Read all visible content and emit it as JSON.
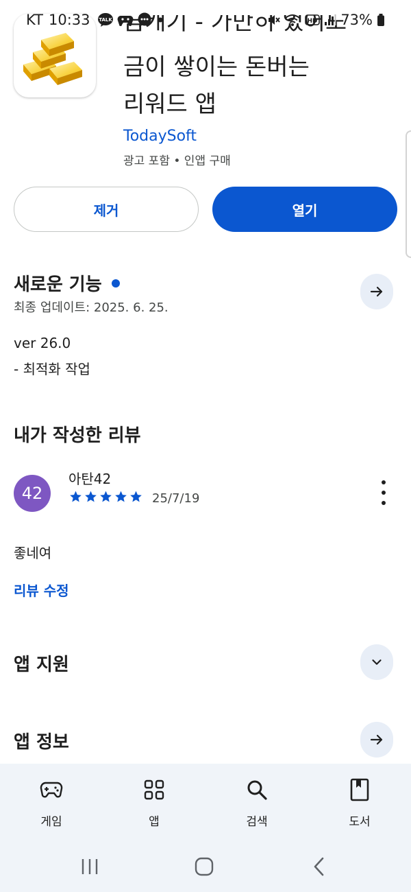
{
  "status_bar": {
    "carrier": "KT",
    "time": "10:33",
    "battery": "73%",
    "notification_icons": [
      "talk-icon",
      "game-controller-icon",
      "chat-bubble-icon",
      "dot-icon"
    ],
    "system_icons": [
      "mute-icon",
      "wifi-icon",
      "hd-icon",
      "signal-icon",
      "battery-icon"
    ]
  },
  "app": {
    "icon": "gold-bars-icon",
    "title_partial_line": "금캐기 - 가만히 있어도",
    "title_line2": "금이 쌓이는 돈버는",
    "title_line3": "리워드 앱",
    "developer": "TodaySoft",
    "meta": "광고 포함 • 인앱 구매"
  },
  "actions": {
    "uninstall_label": "제거",
    "open_label": "열기"
  },
  "whats_new": {
    "title": "새로운 기능",
    "updated": "최종 업데이트: 2025. 6. 25.",
    "version": "ver 26.0",
    "note": "- 최적화 작업"
  },
  "my_review": {
    "title": "내가 작성한 리뷰",
    "avatar_text": "42",
    "reviewer": "아탄42",
    "rating": 5,
    "date": "25/7/19",
    "text": "좋네여",
    "edit_label": "리뷰 수정"
  },
  "app_support": {
    "title": "앱 지원"
  },
  "app_info": {
    "title": "앱 정보"
  },
  "bottom_nav": {
    "items": [
      {
        "label": "게임",
        "icon": "gamepad-icon"
      },
      {
        "label": "앱",
        "icon": "apps-grid-icon"
      },
      {
        "label": "검색",
        "icon": "search-icon"
      },
      {
        "label": "도서",
        "icon": "book-icon"
      }
    ]
  },
  "colors": {
    "accent": "#0b57d0",
    "avatar": "#7e57c2",
    "surface": "#f0f4f9",
    "round_button": "#e8eef7"
  }
}
